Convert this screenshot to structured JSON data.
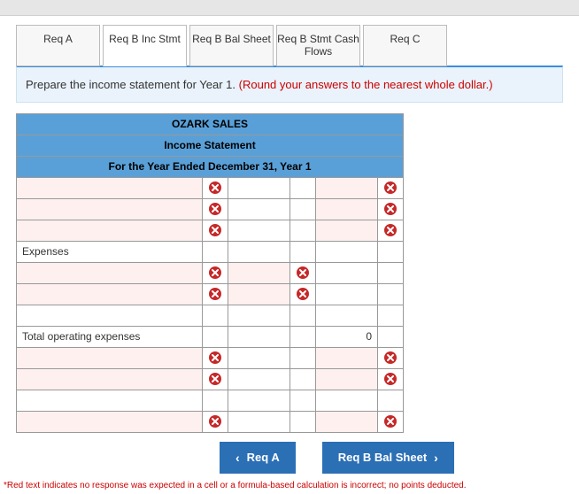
{
  "tabs": [
    {
      "label": "Req A"
    },
    {
      "label": "Req B Inc Stmt"
    },
    {
      "label": "Req B Bal Sheet"
    },
    {
      "label": "Req B Stmt Cash Flows"
    },
    {
      "label": "Req C"
    }
  ],
  "active_tab": 1,
  "instruction": {
    "text": "Prepare the income statement for Year 1. ",
    "note": "(Round your answers to the nearest whole dollar.)"
  },
  "sheet": {
    "title": "OZARK SALES",
    "subtitle": "Income Statement",
    "period": "For the Year Ended December 31, Year 1",
    "rows": [
      {
        "a": "",
        "b_err": true,
        "c": "",
        "d_err": false,
        "e": "",
        "f_err": true,
        "a_pink": true,
        "e_pink": true
      },
      {
        "a": "",
        "b_err": true,
        "c": "",
        "d_err": false,
        "e": "",
        "f_err": true,
        "a_pink": true,
        "e_pink": true
      },
      {
        "a": "",
        "b_err": true,
        "c": "",
        "d_err": false,
        "e": "",
        "f_err": true,
        "a_pink": true,
        "e_pink": true
      },
      {
        "a": "Expenses",
        "b_err": false,
        "c": "",
        "d_err": false,
        "e": "",
        "f_err": false
      },
      {
        "a": "",
        "b_err": true,
        "c": "",
        "d_err": true,
        "e": "",
        "f_err": false,
        "a_pink": true,
        "c_pink": true
      },
      {
        "a": "",
        "b_err": true,
        "c": "",
        "d_err": true,
        "e": "",
        "f_err": false,
        "a_pink": true,
        "c_pink": true
      },
      {
        "a": "",
        "b_err": false,
        "c": "",
        "d_err": false,
        "e": "",
        "f_err": false
      },
      {
        "a": "Total operating expenses",
        "b_err": false,
        "c": "",
        "d_err": false,
        "e": "0",
        "f_err": false,
        "e_right": true
      },
      {
        "a": "",
        "b_err": true,
        "c": "",
        "d_err": false,
        "e": "",
        "f_err": true,
        "a_pink": true,
        "e_pink": true
      },
      {
        "a": "",
        "b_err": true,
        "c": "",
        "d_err": false,
        "e": "",
        "f_err": true,
        "a_pink": true,
        "e_pink": true
      },
      {
        "a": "",
        "b_err": false,
        "c": "",
        "d_err": false,
        "e": "",
        "f_err": false
      },
      {
        "a": "",
        "b_err": true,
        "c": "",
        "d_err": false,
        "e": "",
        "f_err": true,
        "a_pink": true,
        "e_pink": true
      }
    ]
  },
  "nav": {
    "prev": "Req A",
    "next": "Req B Bal Sheet"
  },
  "footnote": "*Red text indicates no response was expected in a cell or a formula-based calculation is incorrect; no points deducted."
}
